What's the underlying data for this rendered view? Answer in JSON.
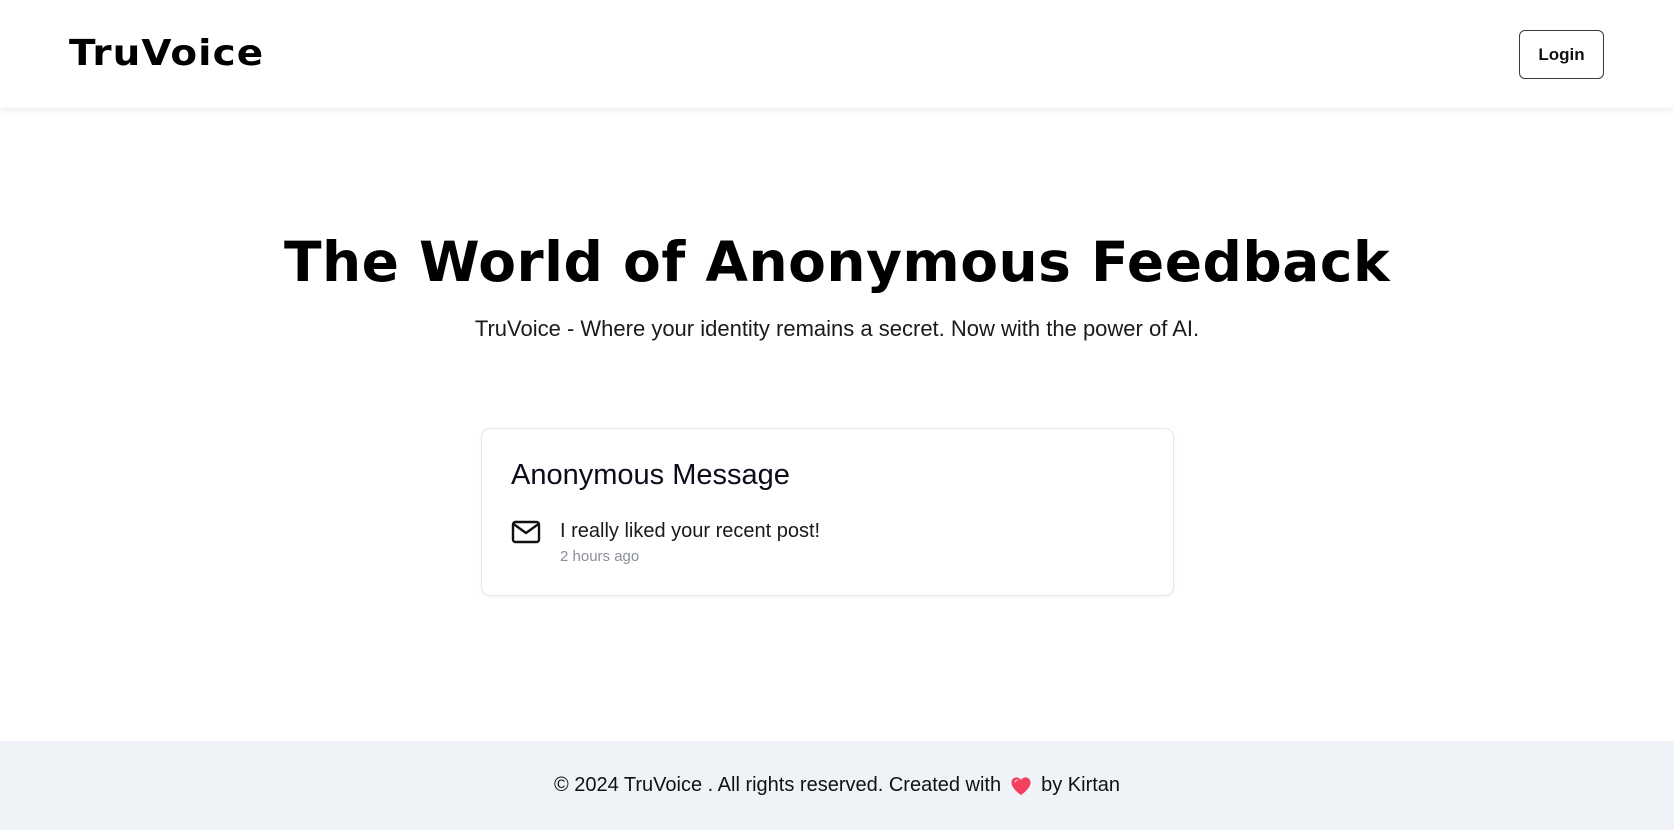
{
  "header": {
    "logo_text": "TruVoice",
    "login_label": "Login"
  },
  "hero": {
    "title": "The World of Anonymous Feedback",
    "subtitle": "TruVoice - Where your identity remains a secret. Now with the power of AI."
  },
  "card": {
    "title": "Anonymous Message",
    "icon": "mail-icon",
    "message": "I really liked your recent post!",
    "time": "2 hours ago"
  },
  "footer": {
    "text_before": "© 2024 TruVoice . All rights reserved. Created with",
    "icon": "heart-icon",
    "heart_color": "#f43f5e",
    "text_after": "by Kirtan"
  },
  "colors": {
    "footer_bg": "#eff2f7",
    "muted_text": "#8a8f98"
  }
}
